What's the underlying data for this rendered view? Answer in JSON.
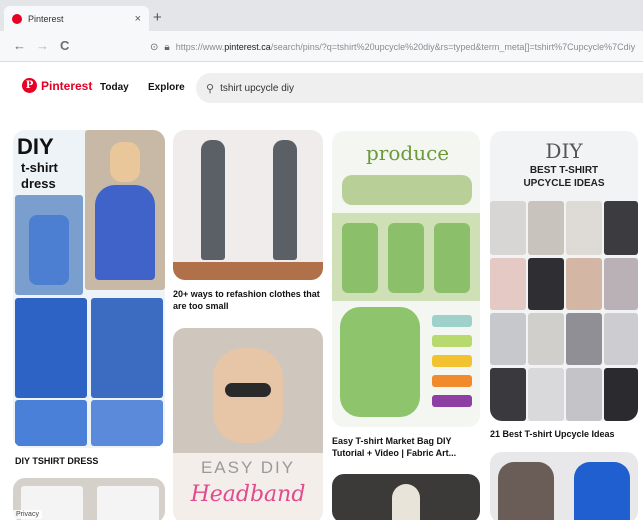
{
  "browser": {
    "tab_title": "Pinterest",
    "tab_close": "×",
    "new_tab": "+",
    "back": "←",
    "forward": "→",
    "reload": "C",
    "url_prefix": "https://www.",
    "url_domain": "pinterest.ca",
    "url_rest": "/search/pins/?q=tshirt%20upcycle%20diy&rs=typed&term_meta[]=tshirt%7Cupcycle%7Cdiy"
  },
  "header": {
    "logo_text": "Pinterest",
    "logo_letter": "P",
    "nav_today": "Today",
    "nav_explore": "Explore",
    "search_value": "tshirt upcycle diy"
  },
  "pins": {
    "c1_title_line1": "DIY",
    "c1_title_line2": "t-shirt",
    "c1_title_line3": "dress",
    "c1_caption": "DIY TSHIRT DRESS",
    "c2_caption": "20+ ways to refashion clothes that are too small",
    "c2b_title": "EASY DIY",
    "c2b_script": "Headband",
    "c3_overlay": "produce",
    "c3_caption": "Easy T-shirt Market Bag DIY Tutorial + Video | Fabric Art...",
    "c4_title_line1": "DIY",
    "c4_title_line2": "BEST T-SHIRT",
    "c4_title_line3": "UPCYCLE IDEAS",
    "c4_caption": "21 Best T-shirt Upcycle Ideas"
  },
  "footer": {
    "privacy": "Privacy"
  },
  "colors": {
    "brand": "#e60023"
  }
}
